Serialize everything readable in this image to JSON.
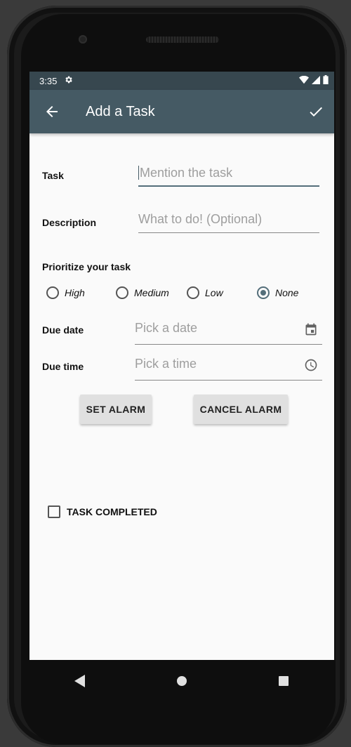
{
  "status_bar": {
    "time": "3:35",
    "settings_icon": "gear-icon",
    "wifi_icon": "wifi-icon",
    "signal_icon": "signal-icon",
    "battery_icon": "battery-icon"
  },
  "toolbar": {
    "title": "Add a Task",
    "back_icon": "arrow-back-icon",
    "confirm_icon": "check-icon",
    "background_color": "#455a64"
  },
  "form": {
    "task_label": "Task",
    "task_placeholder": "Mention the task",
    "description_label": "Description",
    "description_placeholder": "What to do! (Optional)",
    "priority_label": "Prioritize your task",
    "priorities": [
      {
        "label": "High",
        "selected": false
      },
      {
        "label": "Medium",
        "selected": false
      },
      {
        "label": "Low",
        "selected": false
      },
      {
        "label": "None",
        "selected": true
      }
    ],
    "due_date_label": "Due date",
    "due_date_placeholder": "Pick a date",
    "due_date_icon": "calendar-icon",
    "due_time_label": "Due time",
    "due_time_placeholder": "Pick a time",
    "due_time_icon": "clock-icon",
    "set_alarm_label": "SET ALARM",
    "cancel_alarm_label": "CANCEL ALARM",
    "completed_label": "TASK COMPLETED",
    "completed_checked": false
  },
  "nav_bar": {
    "back_icon": "nav-back-icon",
    "home_icon": "nav-home-icon",
    "recents_icon": "nav-recents-icon"
  }
}
